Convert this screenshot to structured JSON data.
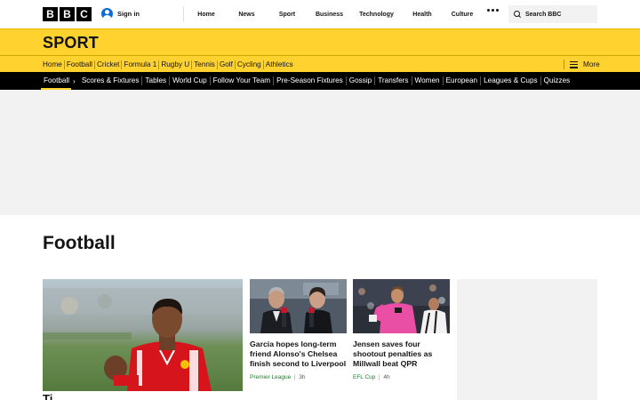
{
  "global": {
    "logo_letters": [
      "B",
      "B",
      "C"
    ],
    "signin_label": "Sign in",
    "nav": [
      "Home",
      "News",
      "Sport",
      "Business",
      "Technology",
      "Health",
      "Culture"
    ],
    "search_label": "Search BBC"
  },
  "sport": {
    "title": "SPORT",
    "nav": [
      "Home",
      "Football",
      "Cricket",
      "Formula 1",
      "Rugby U",
      "Tennis",
      "Golf",
      "Cycling",
      "Athletics"
    ],
    "more_label": "More"
  },
  "football_nav": {
    "items": [
      "Football",
      "Scores & Fixtures",
      "Tables",
      "World Cup",
      "Follow Your Team",
      "Pre-Season Fixtures",
      "Gossip",
      "Transfers",
      "Women",
      "European",
      "Leagues & Cups",
      "Quizzes"
    ]
  },
  "page": {
    "title": "Football",
    "main_headline_partial": "Ti"
  },
  "cards": [
    {
      "headline": "Garcia hopes long-term friend Alonso's Chelsea finish second to Liverpool",
      "tag": "Premier League",
      "time": "3h"
    },
    {
      "headline": "Jensen saves four shootout penalties as Millwall beat QPR",
      "tag": "EFL Cup",
      "time": "4h"
    }
  ],
  "colors": {
    "sport_yellow": "#ffd230",
    "subnav_black": "#000000",
    "tag_green": "#1c7e2c"
  }
}
